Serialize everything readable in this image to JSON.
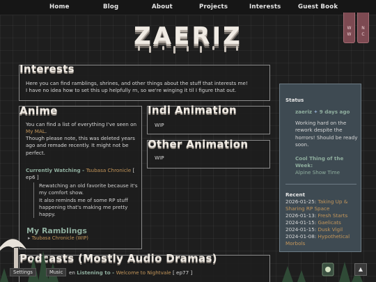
{
  "nav": [
    {
      "label": "Home"
    },
    {
      "label": "Blog"
    },
    {
      "label": "About"
    },
    {
      "label": "Projects"
    },
    {
      "label": "Interests"
    },
    {
      "label": "Guest Book"
    }
  ],
  "site_title": "ZAERIZ",
  "side_tabs": [
    {
      "label": "W\nW"
    },
    {
      "label": "N\nC"
    }
  ],
  "interests": {
    "heading": "Interests",
    "line1": "Here you can find ramblings, shrines, and other things about the stuff that interests me!",
    "line2": "I have no idea how to set this up helpfully rn, so we're winging it til I figure that out."
  },
  "anime": {
    "heading": "Anime",
    "intro_prefix": "You can find a list of everything I've seen on ",
    "intro_link": "My MAL",
    "intro_suffix": ".",
    "note": "Though please note, this was deleted years ago and remade recently. It might not be perfect.",
    "watching_label": "Currently Watching - ",
    "watching_title": "Tsubasa Chronicle",
    "watching_ep_open": " [",
    "watching_ep": "ep6 ]",
    "quote1": "Rewatching an old favorite because it's my comfort show.",
    "quote2": "It also reminds me of some RP stuff happening that's making me pretty happy.",
    "ramblings_heading": "My Ramblings",
    "ramblings_item": "Tsubasa Chronicle (WIP)"
  },
  "indie_animation": {
    "heading": "Indi Animation",
    "body": "WIP"
  },
  "other_animation": {
    "heading": "Other Animation",
    "body": "WIP"
  },
  "podcasts": {
    "heading": "Podcasts (Mostly Audio Dramas)",
    "line_prefix": "en",
    "line_label": "Listening to - ",
    "line_title": "Welcome to Nightvale",
    "line_ep": " [ ep77 ]"
  },
  "status": {
    "label": "Status",
    "author": "zaeriz",
    "time": "9 days ago",
    "body": "Working hard on the rework despite the horrors! Should be ready soon.",
    "cool_label": "Cool Thing of the Week:",
    "cool_value": "Alpine Show Time"
  },
  "recent": {
    "label": "Recent",
    "items": [
      {
        "date": "2026-01-25:",
        "title": "Taking Up & Sharing RP Space"
      },
      {
        "date": "2026-01-13:",
        "title": "Fresh Starts"
      },
      {
        "date": "2024-01-15:",
        "title": "Gaelicats"
      },
      {
        "date": "2024-01-15:",
        "title": "Dusk Vigil"
      },
      {
        "date": "2024-01-08:",
        "title": "Hypothetical Morbols"
      }
    ]
  },
  "controls": {
    "settings": "Settings",
    "music": "Music",
    "scroll_top": "▲"
  },
  "colors": {
    "accent_orange": "#c4965a",
    "accent_green": "#8fae9e",
    "tab_pink": "#7d4a52",
    "sidebar_bg": "#3e4a52"
  }
}
